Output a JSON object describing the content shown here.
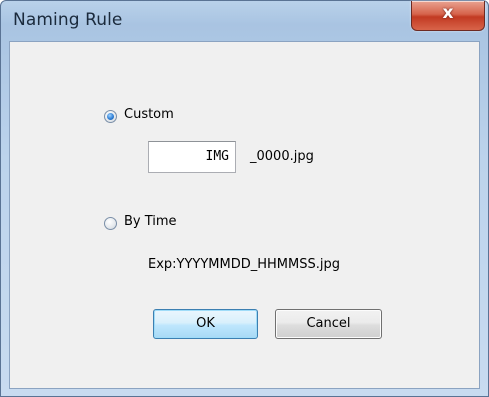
{
  "window": {
    "title": "Naming Rule",
    "close_glyph": "x"
  },
  "options": {
    "custom": {
      "label": "Custom",
      "checked": true,
      "prefix_value": "IMG",
      "suffix_text": "_0000.jpg"
    },
    "by_time": {
      "label": "By Time",
      "checked": false,
      "example_text": "Exp:YYYYMMDD_HHMMSS.jpg"
    }
  },
  "buttons": {
    "ok_label": "OK",
    "cancel_label": "Cancel"
  },
  "icons": {
    "close": "close-icon",
    "radio_custom": "radio-checked-icon",
    "radio_by_time": "radio-unchecked-icon"
  },
  "colors": {
    "title_bar": "#b9d1ea",
    "client_bg": "#f0f0f0",
    "close_button": "#c23a22",
    "default_button_border": "#3c7fb1"
  }
}
